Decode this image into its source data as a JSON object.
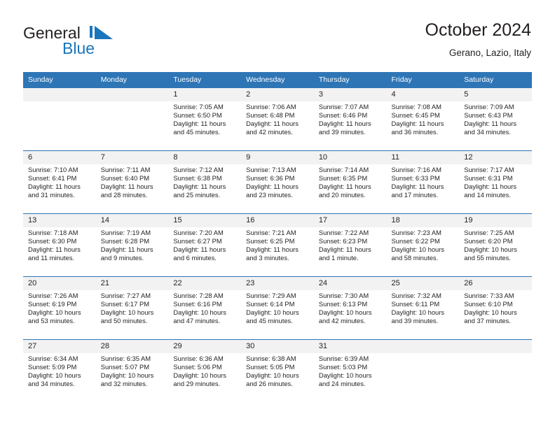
{
  "brand": {
    "name_part1": "General",
    "name_part2": "Blue",
    "logo_icon": "triangle-logo-mark",
    "color_primary": "#1b75bb",
    "color_text": "#231f20"
  },
  "header": {
    "title": "October 2024",
    "subtitle": "Gerano, Lazio, Italy"
  },
  "theme": {
    "header_bg": "#2e75b6",
    "daynum_bg": "#f2f2f2",
    "border": "#2e75b6"
  },
  "calendar": {
    "weekday_headers": [
      "Sunday",
      "Monday",
      "Tuesday",
      "Wednesday",
      "Thursday",
      "Friday",
      "Saturday"
    ],
    "weeks": [
      [
        {
          "day": "",
          "empty": true,
          "sunrise": "",
          "sunset": "",
          "daylight_line1": "",
          "daylight_line2": ""
        },
        {
          "day": "",
          "empty": true,
          "sunrise": "",
          "sunset": "",
          "daylight_line1": "",
          "daylight_line2": ""
        },
        {
          "day": "1",
          "sunrise": "Sunrise: 7:05 AM",
          "sunset": "Sunset: 6:50 PM",
          "daylight_line1": "Daylight: 11 hours",
          "daylight_line2": "and 45 minutes."
        },
        {
          "day": "2",
          "sunrise": "Sunrise: 7:06 AM",
          "sunset": "Sunset: 6:48 PM",
          "daylight_line1": "Daylight: 11 hours",
          "daylight_line2": "and 42 minutes."
        },
        {
          "day": "3",
          "sunrise": "Sunrise: 7:07 AM",
          "sunset": "Sunset: 6:46 PM",
          "daylight_line1": "Daylight: 11 hours",
          "daylight_line2": "and 39 minutes."
        },
        {
          "day": "4",
          "sunrise": "Sunrise: 7:08 AM",
          "sunset": "Sunset: 6:45 PM",
          "daylight_line1": "Daylight: 11 hours",
          "daylight_line2": "and 36 minutes."
        },
        {
          "day": "5",
          "sunrise": "Sunrise: 7:09 AM",
          "sunset": "Sunset: 6:43 PM",
          "daylight_line1": "Daylight: 11 hours",
          "daylight_line2": "and 34 minutes."
        }
      ],
      [
        {
          "day": "6",
          "sunrise": "Sunrise: 7:10 AM",
          "sunset": "Sunset: 6:41 PM",
          "daylight_line1": "Daylight: 11 hours",
          "daylight_line2": "and 31 minutes."
        },
        {
          "day": "7",
          "sunrise": "Sunrise: 7:11 AM",
          "sunset": "Sunset: 6:40 PM",
          "daylight_line1": "Daylight: 11 hours",
          "daylight_line2": "and 28 minutes."
        },
        {
          "day": "8",
          "sunrise": "Sunrise: 7:12 AM",
          "sunset": "Sunset: 6:38 PM",
          "daylight_line1": "Daylight: 11 hours",
          "daylight_line2": "and 25 minutes."
        },
        {
          "day": "9",
          "sunrise": "Sunrise: 7:13 AM",
          "sunset": "Sunset: 6:36 PM",
          "daylight_line1": "Daylight: 11 hours",
          "daylight_line2": "and 23 minutes."
        },
        {
          "day": "10",
          "sunrise": "Sunrise: 7:14 AM",
          "sunset": "Sunset: 6:35 PM",
          "daylight_line1": "Daylight: 11 hours",
          "daylight_line2": "and 20 minutes."
        },
        {
          "day": "11",
          "sunrise": "Sunrise: 7:16 AM",
          "sunset": "Sunset: 6:33 PM",
          "daylight_line1": "Daylight: 11 hours",
          "daylight_line2": "and 17 minutes."
        },
        {
          "day": "12",
          "sunrise": "Sunrise: 7:17 AM",
          "sunset": "Sunset: 6:31 PM",
          "daylight_line1": "Daylight: 11 hours",
          "daylight_line2": "and 14 minutes."
        }
      ],
      [
        {
          "day": "13",
          "sunrise": "Sunrise: 7:18 AM",
          "sunset": "Sunset: 6:30 PM",
          "daylight_line1": "Daylight: 11 hours",
          "daylight_line2": "and 11 minutes."
        },
        {
          "day": "14",
          "sunrise": "Sunrise: 7:19 AM",
          "sunset": "Sunset: 6:28 PM",
          "daylight_line1": "Daylight: 11 hours",
          "daylight_line2": "and 9 minutes."
        },
        {
          "day": "15",
          "sunrise": "Sunrise: 7:20 AM",
          "sunset": "Sunset: 6:27 PM",
          "daylight_line1": "Daylight: 11 hours",
          "daylight_line2": "and 6 minutes."
        },
        {
          "day": "16",
          "sunrise": "Sunrise: 7:21 AM",
          "sunset": "Sunset: 6:25 PM",
          "daylight_line1": "Daylight: 11 hours",
          "daylight_line2": "and 3 minutes."
        },
        {
          "day": "17",
          "sunrise": "Sunrise: 7:22 AM",
          "sunset": "Sunset: 6:23 PM",
          "daylight_line1": "Daylight: 11 hours",
          "daylight_line2": "and 1 minute."
        },
        {
          "day": "18",
          "sunrise": "Sunrise: 7:23 AM",
          "sunset": "Sunset: 6:22 PM",
          "daylight_line1": "Daylight: 10 hours",
          "daylight_line2": "and 58 minutes."
        },
        {
          "day": "19",
          "sunrise": "Sunrise: 7:25 AM",
          "sunset": "Sunset: 6:20 PM",
          "daylight_line1": "Daylight: 10 hours",
          "daylight_line2": "and 55 minutes."
        }
      ],
      [
        {
          "day": "20",
          "sunrise": "Sunrise: 7:26 AM",
          "sunset": "Sunset: 6:19 PM",
          "daylight_line1": "Daylight: 10 hours",
          "daylight_line2": "and 53 minutes."
        },
        {
          "day": "21",
          "sunrise": "Sunrise: 7:27 AM",
          "sunset": "Sunset: 6:17 PM",
          "daylight_line1": "Daylight: 10 hours",
          "daylight_line2": "and 50 minutes."
        },
        {
          "day": "22",
          "sunrise": "Sunrise: 7:28 AM",
          "sunset": "Sunset: 6:16 PM",
          "daylight_line1": "Daylight: 10 hours",
          "daylight_line2": "and 47 minutes."
        },
        {
          "day": "23",
          "sunrise": "Sunrise: 7:29 AM",
          "sunset": "Sunset: 6:14 PM",
          "daylight_line1": "Daylight: 10 hours",
          "daylight_line2": "and 45 minutes."
        },
        {
          "day": "24",
          "sunrise": "Sunrise: 7:30 AM",
          "sunset": "Sunset: 6:13 PM",
          "daylight_line1": "Daylight: 10 hours",
          "daylight_line2": "and 42 minutes."
        },
        {
          "day": "25",
          "sunrise": "Sunrise: 7:32 AM",
          "sunset": "Sunset: 6:11 PM",
          "daylight_line1": "Daylight: 10 hours",
          "daylight_line2": "and 39 minutes."
        },
        {
          "day": "26",
          "sunrise": "Sunrise: 7:33 AM",
          "sunset": "Sunset: 6:10 PM",
          "daylight_line1": "Daylight: 10 hours",
          "daylight_line2": "and 37 minutes."
        }
      ],
      [
        {
          "day": "27",
          "sunrise": "Sunrise: 6:34 AM",
          "sunset": "Sunset: 5:09 PM",
          "daylight_line1": "Daylight: 10 hours",
          "daylight_line2": "and 34 minutes."
        },
        {
          "day": "28",
          "sunrise": "Sunrise: 6:35 AM",
          "sunset": "Sunset: 5:07 PM",
          "daylight_line1": "Daylight: 10 hours",
          "daylight_line2": "and 32 minutes."
        },
        {
          "day": "29",
          "sunrise": "Sunrise: 6:36 AM",
          "sunset": "Sunset: 5:06 PM",
          "daylight_line1": "Daylight: 10 hours",
          "daylight_line2": "and 29 minutes."
        },
        {
          "day": "30",
          "sunrise": "Sunrise: 6:38 AM",
          "sunset": "Sunset: 5:05 PM",
          "daylight_line1": "Daylight: 10 hours",
          "daylight_line2": "and 26 minutes."
        },
        {
          "day": "31",
          "sunrise": "Sunrise: 6:39 AM",
          "sunset": "Sunset: 5:03 PM",
          "daylight_line1": "Daylight: 10 hours",
          "daylight_line2": "and 24 minutes."
        },
        {
          "day": "",
          "empty": true,
          "sunrise": "",
          "sunset": "",
          "daylight_line1": "",
          "daylight_line2": ""
        },
        {
          "day": "",
          "empty": true,
          "sunrise": "",
          "sunset": "",
          "daylight_line1": "",
          "daylight_line2": ""
        }
      ]
    ]
  }
}
